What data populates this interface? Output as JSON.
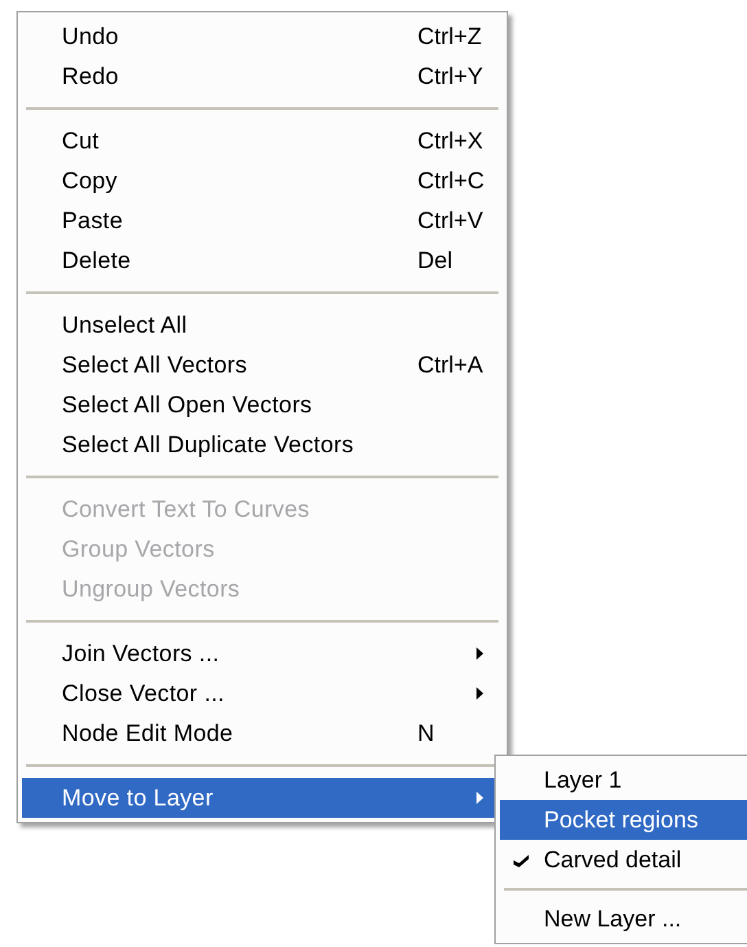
{
  "menu": {
    "groups": [
      {
        "items": [
          {
            "label": "Undo",
            "shortcut": "Ctrl+Z",
            "disabled": false,
            "submenu": false,
            "selected": false
          },
          {
            "label": "Redo",
            "shortcut": "Ctrl+Y",
            "disabled": false,
            "submenu": false,
            "selected": false
          }
        ]
      },
      {
        "items": [
          {
            "label": "Cut",
            "shortcut": "Ctrl+X",
            "disabled": false,
            "submenu": false,
            "selected": false
          },
          {
            "label": "Copy",
            "shortcut": "Ctrl+C",
            "disabled": false,
            "submenu": false,
            "selected": false
          },
          {
            "label": "Paste",
            "shortcut": "Ctrl+V",
            "disabled": false,
            "submenu": false,
            "selected": false
          },
          {
            "label": "Delete",
            "shortcut": "Del",
            "disabled": false,
            "submenu": false,
            "selected": false
          }
        ]
      },
      {
        "items": [
          {
            "label": "Unselect All",
            "disabled": false,
            "submenu": false,
            "selected": false
          },
          {
            "label": "Select All Vectors",
            "shortcut": "Ctrl+A",
            "disabled": false,
            "submenu": false,
            "selected": false
          },
          {
            "label": "Select All Open Vectors",
            "disabled": false,
            "submenu": false,
            "selected": false
          },
          {
            "label": "Select All Duplicate Vectors",
            "disabled": false,
            "submenu": false,
            "selected": false
          }
        ]
      },
      {
        "items": [
          {
            "label": "Convert Text To Curves",
            "disabled": true,
            "submenu": false,
            "selected": false
          },
          {
            "label": "Group Vectors",
            "disabled": true,
            "submenu": false,
            "selected": false
          },
          {
            "label": "Ungroup Vectors",
            "disabled": true,
            "submenu": false,
            "selected": false
          }
        ]
      },
      {
        "items": [
          {
            "label": "Join Vectors ...",
            "disabled": false,
            "submenu": true,
            "selected": false
          },
          {
            "label": "Close Vector ...",
            "disabled": false,
            "submenu": true,
            "selected": false
          },
          {
            "label": "Node Edit Mode",
            "shortcut": "N",
            "disabled": false,
            "submenu": false,
            "selected": false
          }
        ]
      },
      {
        "items": [
          {
            "label": "Move to Layer",
            "disabled": false,
            "submenu": true,
            "selected": true
          }
        ]
      }
    ]
  },
  "submenu": {
    "groups": [
      {
        "items": [
          {
            "label": "Layer 1",
            "checked": false,
            "selected": false
          },
          {
            "label": "Pocket regions",
            "checked": false,
            "selected": true
          },
          {
            "label": "Carved detail",
            "checked": true,
            "selected": false
          }
        ]
      },
      {
        "items": [
          {
            "label": "New Layer ...",
            "checked": false,
            "selected": false
          }
        ]
      }
    ]
  }
}
